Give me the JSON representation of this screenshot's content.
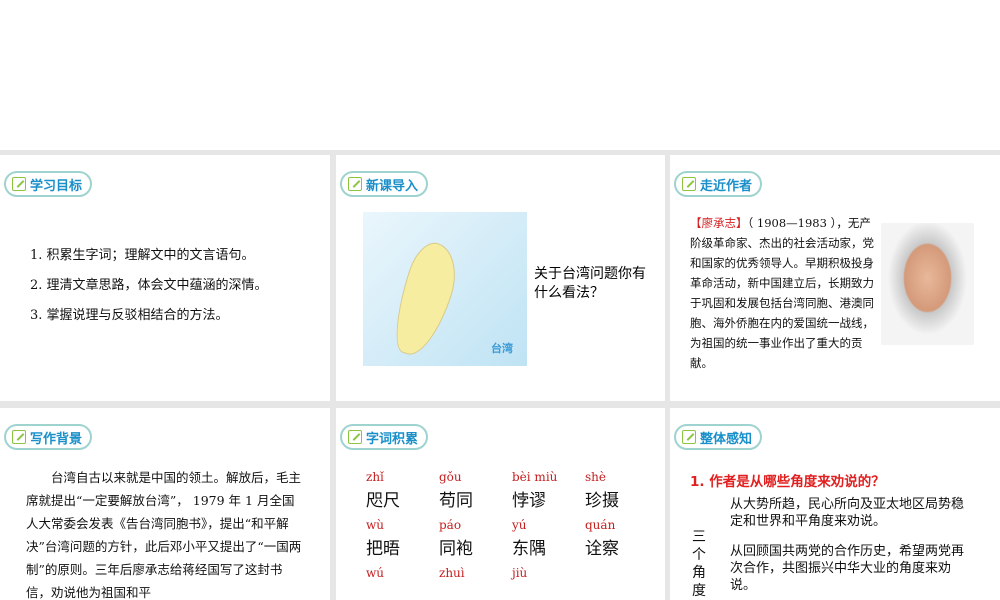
{
  "slides": {
    "goals": {
      "title": "学习目标",
      "items": [
        "1. 积累生字词；理解文中的文言语句。",
        "2. 理清文章思路，体会文中蕴涵的深情。",
        "3. 掌握说理与反驳相结合的方法。"
      ]
    },
    "intro": {
      "title": "新课导入",
      "map_label": "台湾",
      "question": "关于台湾问题你有什么看法？"
    },
    "author": {
      "title": "走近作者",
      "name": "【廖承志】",
      "text": "（ 1908—1983 ），无产阶级革命家、杰出的社会活动家，党和国家的优秀领导人。早期积极投身革命活动，新中国建立后，长期致力于巩固和发展包括台湾同胞、港澳同胞、海外侨胞在内的爱国统一战线，为祖国的统一事业作出了重大的贡献。"
    },
    "background": {
      "title": "写作背景",
      "text": "台湾自古以来就是中国的领土。解放后，毛主席就提出“一定要解放台湾”， 1979 年 1 月全国人大常委会发表《告台湾同胞书》，提出“和平解决”台湾问题的方针，此后邓小平又提出了“一国两制”的原则。三年后廖承志给蒋经国写了这封书信，劝说他为祖国和平"
    },
    "vocab": {
      "title": "字词积累",
      "rows": [
        [
          {
            "py": "zhǐ",
            "w": "咫尺"
          },
          {
            "py": "gǒu",
            "w": "苟同"
          },
          {
            "py": "bèi miù",
            "w": "悖谬"
          },
          {
            "py": "shè",
            "w": "珍摄"
          }
        ],
        [
          {
            "py": "wù",
            "w": "把晤"
          },
          {
            "py": "páo",
            "w": "同袍"
          },
          {
            "py": "yú",
            "w": "东隅"
          },
          {
            "py": "quán",
            "w": "诠察"
          }
        ],
        [
          {
            "py": "wú",
            "w": ""
          },
          {
            "py": "zhuì",
            "w": ""
          },
          {
            "py": "jiù",
            "w": ""
          }
        ]
      ]
    },
    "overview": {
      "title": "整体感知",
      "question": "1. 作者是从哪些角度来劝说的？",
      "side_label": "三个角度",
      "angles": [
        "从大势所趋，民心所向及亚太地区局势稳定和世界和平角度来劝说。",
        "从回顾国共两党的合作历史，希望两党再次合作，共图振兴中华大业的角度来劝说。"
      ]
    }
  }
}
